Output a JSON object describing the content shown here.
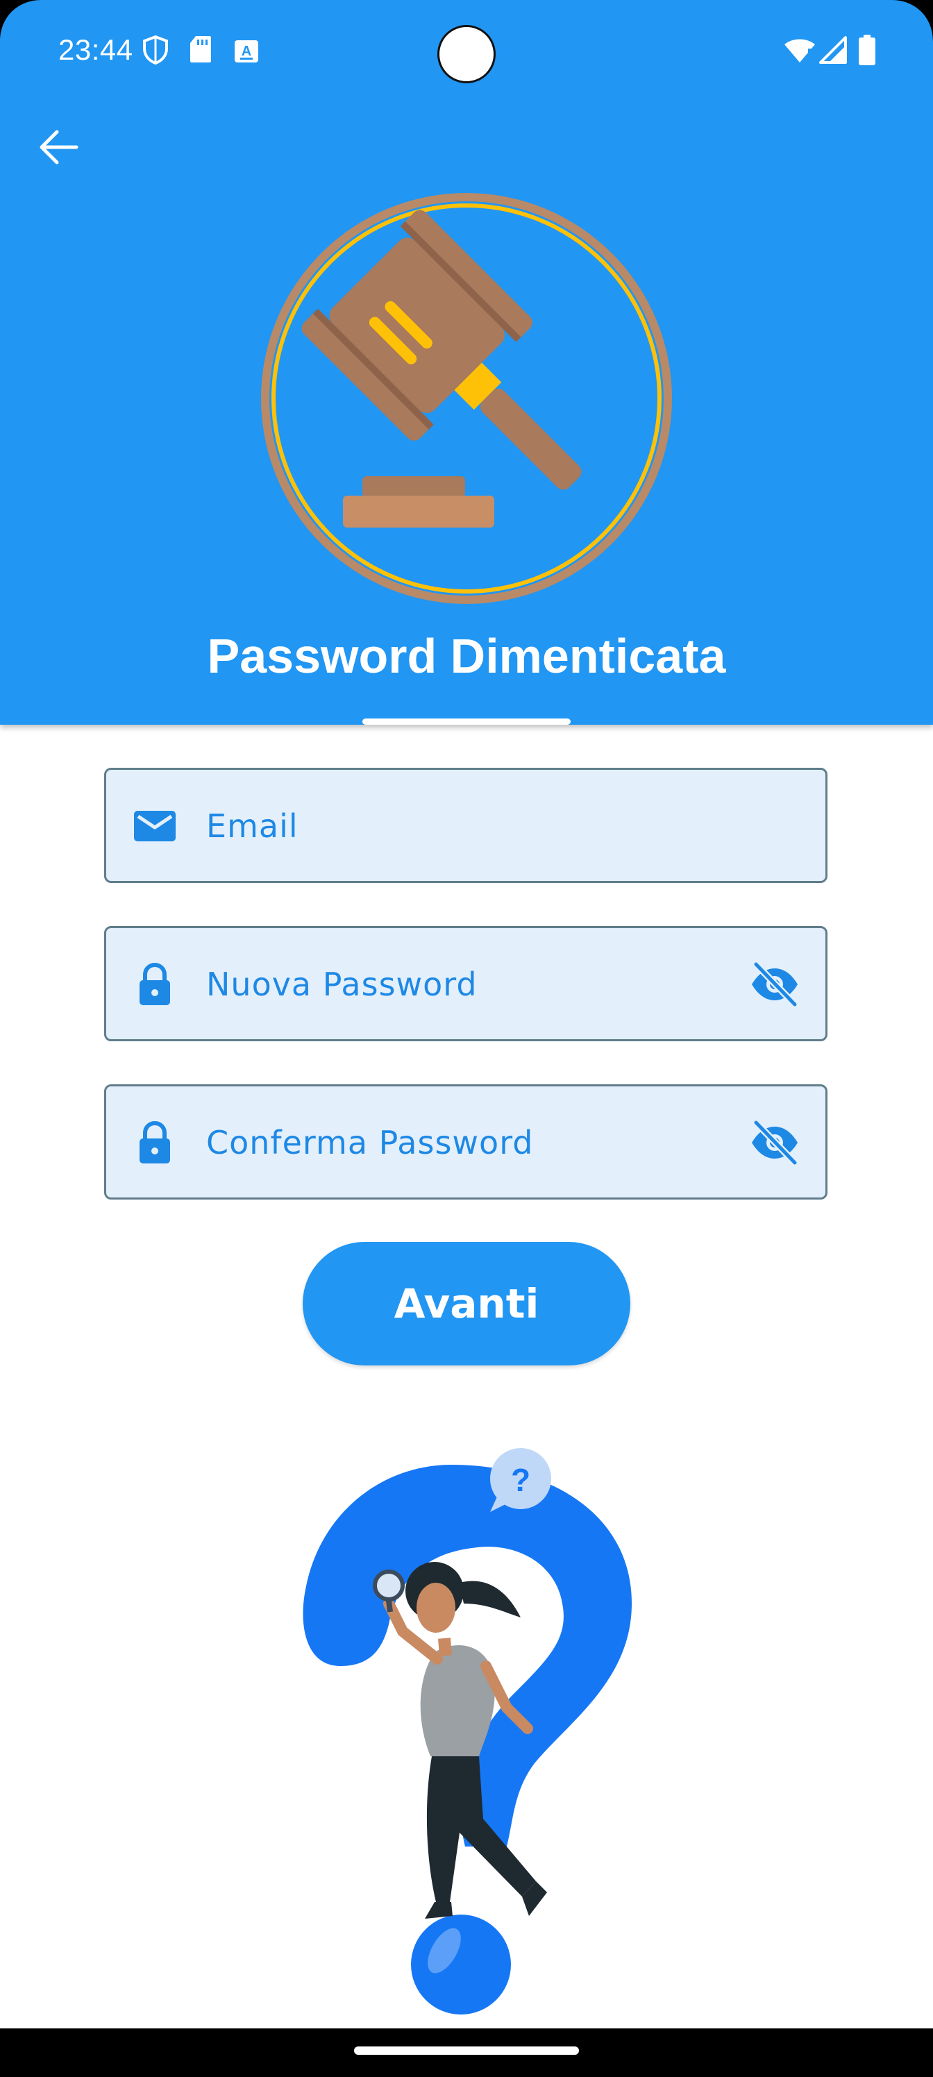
{
  "status_bar": {
    "time": "23:44",
    "left_icons": [
      "shield-icon",
      "sd-card-icon",
      "keyboard-a-icon"
    ],
    "right_icons": [
      "wifi-icon",
      "signal-icon",
      "battery-icon"
    ]
  },
  "header": {
    "back_icon": "arrow-back-icon",
    "logo_icon": "gavel-icon",
    "title": "Password Dimenticata",
    "background_color": "#2196F3"
  },
  "form": {
    "email": {
      "placeholder": "Email",
      "icon": "email-icon"
    },
    "new_password": {
      "placeholder": "Nuova Password",
      "icon": "lock-icon",
      "toggle_icon": "eye-off-icon"
    },
    "confirm_password": {
      "placeholder": "Conferma Password",
      "icon": "lock-icon",
      "toggle_icon": "eye-off-icon"
    },
    "submit_label": "Avanti"
  },
  "illustration": {
    "icon": "question-mark-search-illustration",
    "bubble_text": "?"
  },
  "colors": {
    "primary": "#2196F3",
    "field_bg": "#E3F0FB",
    "field_border": "#607D8B",
    "field_text": "#1E88E5"
  }
}
